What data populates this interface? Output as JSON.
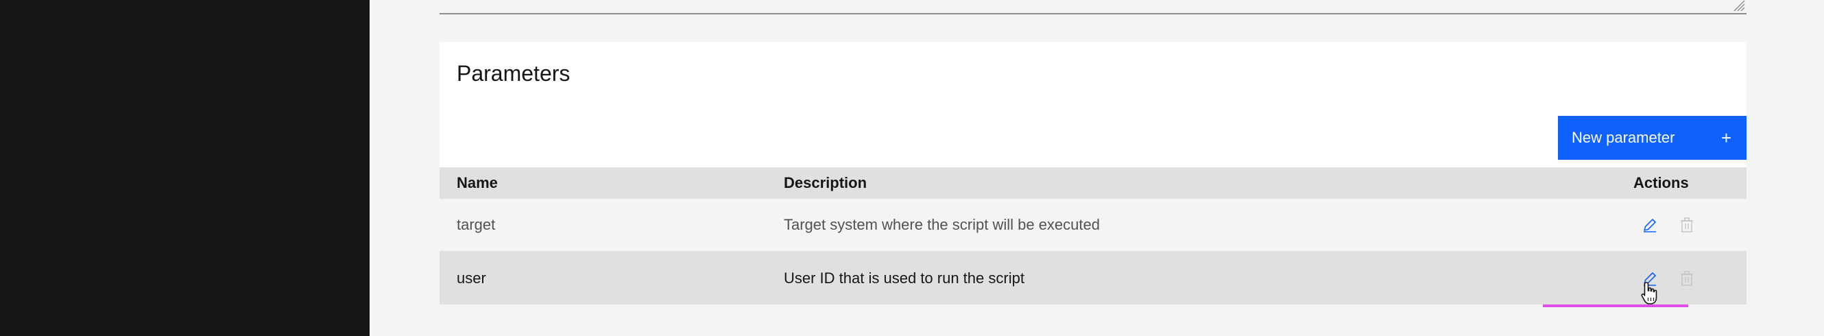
{
  "parameters": {
    "title": "Parameters",
    "new_button": {
      "label": "New parameter",
      "icon": "plus-icon",
      "plus_glyph": "+"
    },
    "table": {
      "headers": {
        "name": "Name",
        "description": "Description",
        "actions": "Actions"
      },
      "rows": [
        {
          "name": "target",
          "description": "Target system where the script will be executed"
        },
        {
          "name": "user",
          "description": "User ID that is used to run the script"
        }
      ]
    }
  },
  "colors": {
    "primary": "#0f62fe",
    "sidebar": "#161616",
    "focus": "#e04ce8"
  }
}
